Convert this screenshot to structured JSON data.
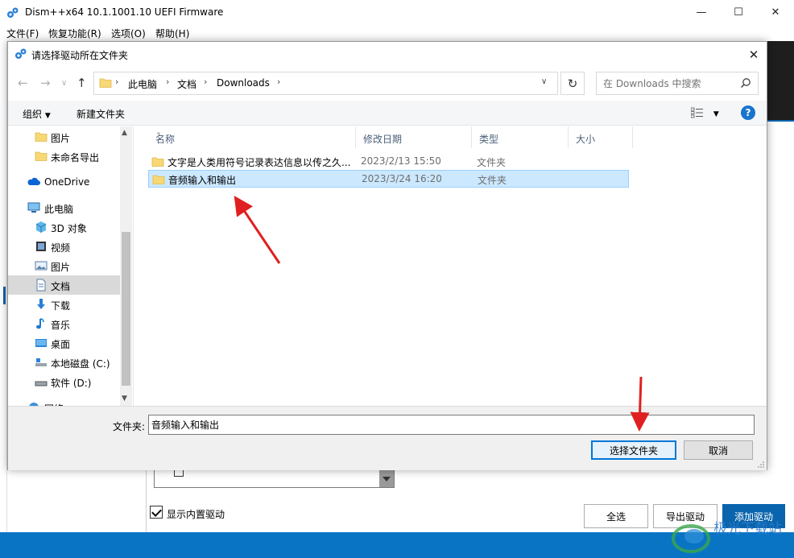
{
  "main_window": {
    "title": "Dism++x64 10.1.1001.10 UEFI Firmware",
    "menu": [
      "文件(F)",
      "恢复功能(R)",
      "选项(O)",
      "帮助(H)"
    ],
    "show_builtin_drivers_label": "显示内置驱动",
    "show_builtin_drivers_checked": true,
    "buttons": {
      "select_all": "全选",
      "export_driver": "导出驱动",
      "add_driver": "添加驱动"
    }
  },
  "dialog": {
    "title": "请选择驱动所在文件夹",
    "breadcrumb": [
      "此电脑",
      "文档",
      "Downloads"
    ],
    "search_placeholder": "在 Downloads 中搜索",
    "toolbar": {
      "organize": "组织",
      "new_folder": "新建文件夹"
    },
    "nav_items": [
      {
        "label": "图片",
        "icon": "folder-icon"
      },
      {
        "label": "未命名导出",
        "icon": "folder-icon"
      },
      {
        "label": "OneDrive",
        "icon": "cloud-icon"
      },
      {
        "label": "此电脑",
        "icon": "computer-icon"
      },
      {
        "label": "3D 对象",
        "icon": "cube-icon"
      },
      {
        "label": "视频",
        "icon": "video-icon"
      },
      {
        "label": "图片",
        "icon": "picture-icon"
      },
      {
        "label": "文档",
        "icon": "document-icon",
        "selected": true
      },
      {
        "label": "下载",
        "icon": "download-icon"
      },
      {
        "label": "音乐",
        "icon": "music-icon"
      },
      {
        "label": "桌面",
        "icon": "desktop-icon"
      },
      {
        "label": "本地磁盘 (C:)",
        "icon": "drive-icon"
      },
      {
        "label": "软件 (D:)",
        "icon": "drive-icon"
      },
      {
        "label": "网络",
        "icon": "network-icon"
      }
    ],
    "columns": {
      "name": "名称",
      "modified": "修改日期",
      "type": "类型",
      "size": "大小"
    },
    "files": [
      {
        "name": "文字是人类用符号记录表达信息以传之久...",
        "modified": "2023/2/13 15:50",
        "type": "文件夹",
        "selected": false
      },
      {
        "name": "音频输入和输出",
        "modified": "2023/3/24 16:20",
        "type": "文件夹",
        "selected": true
      }
    ],
    "folder_label": "文件夹:",
    "folder_value": "音频输入和输出",
    "buttons": {
      "select_folder": "选择文件夹",
      "cancel": "取消"
    }
  },
  "colors": {
    "accent": "#0a64ad",
    "statusbar": "#0a74c4",
    "selection": "#cce8ff",
    "annotation_arrow": "#e02020"
  },
  "watermark_text": "极光下载站"
}
